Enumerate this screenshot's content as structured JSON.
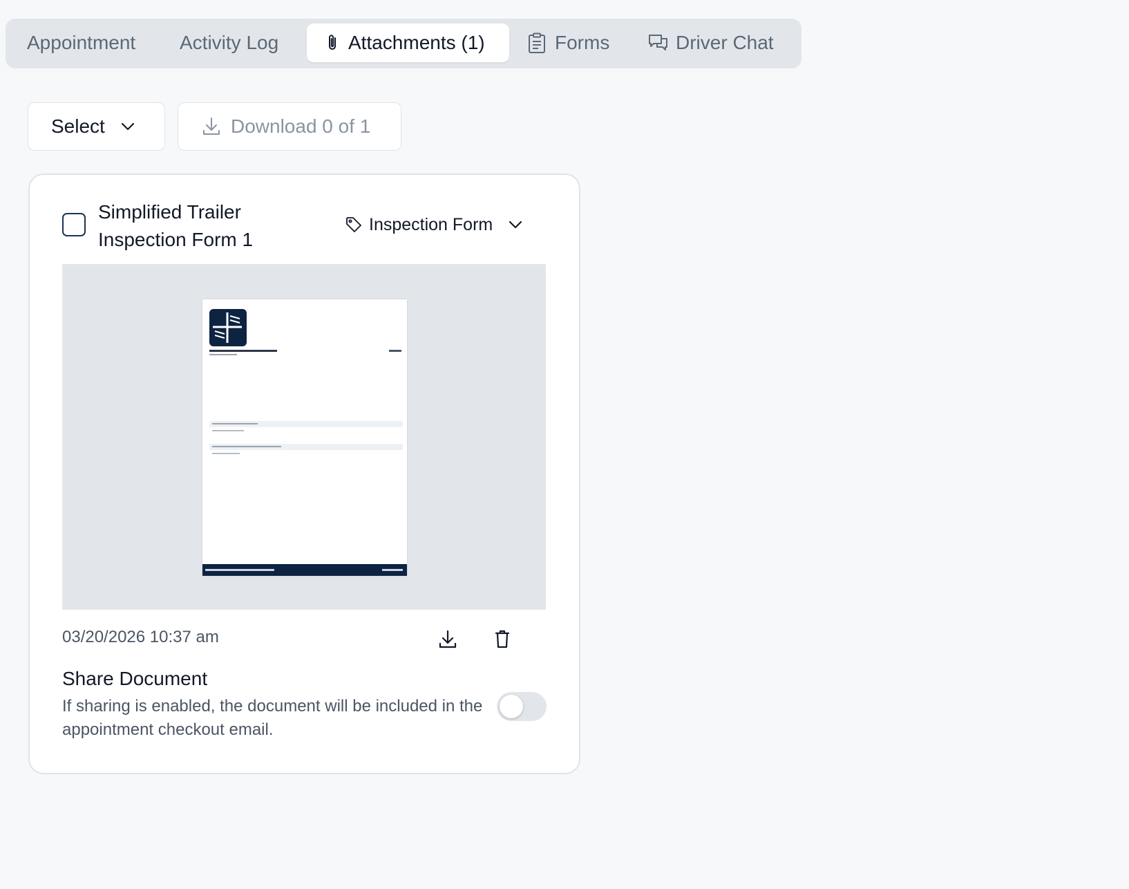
{
  "tabs": [
    {
      "label": "Appointment",
      "icon": "",
      "active": false
    },
    {
      "label": "Activity Log",
      "icon": "",
      "active": false
    },
    {
      "label": "Attachments (1)",
      "icon": "paperclip-icon",
      "active": true
    },
    {
      "label": "Forms",
      "icon": "clipboard-icon",
      "active": false
    },
    {
      "label": "Driver Chat",
      "icon": "chat-bubbles-icon",
      "active": false
    }
  ],
  "toolbar": {
    "select_label": "Select",
    "download_label": "Download 0 of 1"
  },
  "attachment": {
    "title": "Simplified Trailer Inspection Form 1",
    "tag_label": "Inspection Form",
    "timestamp": "03/20/2026 10:37 am",
    "share_title": "Share Document",
    "share_description": "If sharing is enabled, the document will be included in the appointment checkout email.",
    "share_enabled": false,
    "checked": false
  },
  "colors": {
    "brand_navy": "#0d2341",
    "tab_bar_bg": "#e2e6ea",
    "page_bg": "#f7f8fa",
    "muted_text": "#5b6876"
  }
}
